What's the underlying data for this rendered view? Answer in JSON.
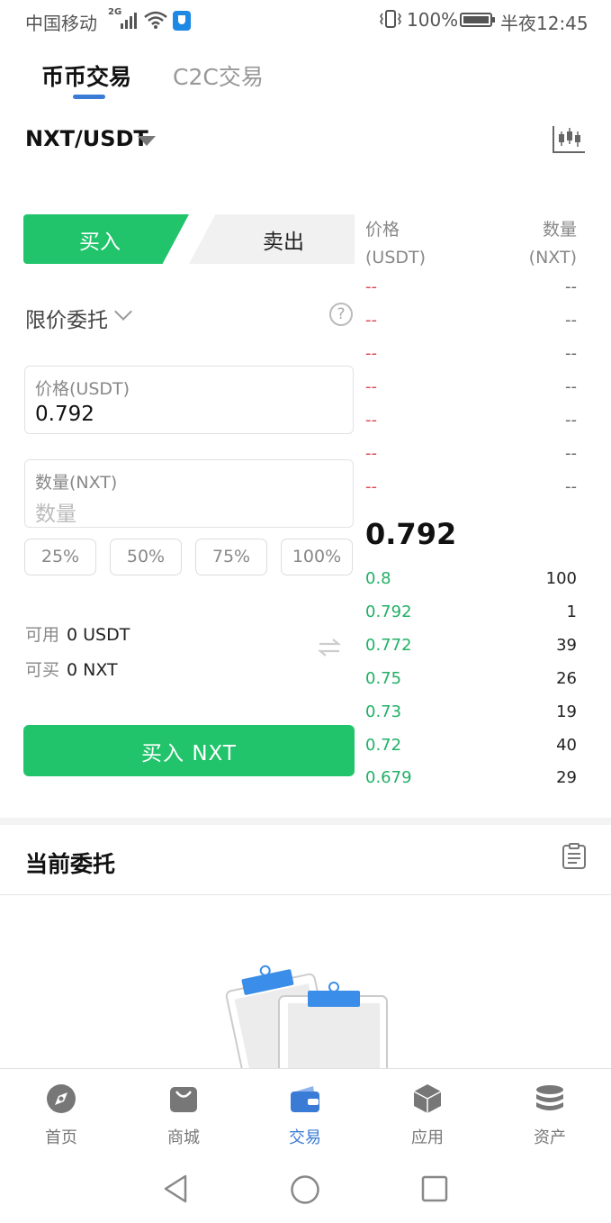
{
  "status_bar": {
    "carrier": "中国移动",
    "network": "2G",
    "battery_pct": "100%",
    "time": "半夜12:45"
  },
  "tabs": [
    {
      "label": "币币交易",
      "active": true
    },
    {
      "label": "C2C交易",
      "active": false
    }
  ],
  "pair": {
    "name": "NXT/USDT"
  },
  "side": {
    "buy": "买入",
    "sell": "卖出",
    "selected": "buy"
  },
  "order_type": {
    "label": "限价委托",
    "help_glyph": "?"
  },
  "price_field": {
    "label": "价格(USDT)",
    "value": "0.792"
  },
  "qty_field": {
    "label": "数量(NXT)",
    "placeholder": "数量"
  },
  "percent_buttons": [
    "25%",
    "50%",
    "75%",
    "100%"
  ],
  "available": {
    "usable_label": "可用",
    "usable_value": "0 USDT",
    "buyable_label": "可买",
    "buyable_value": "0 NXT"
  },
  "submit_label": "买入 NXT",
  "order_book": {
    "price_header": "价格",
    "price_unit": "(USDT)",
    "qty_header": "数量",
    "qty_unit": "(NXT)",
    "asks": [
      {
        "price": "--",
        "qty": "--"
      },
      {
        "price": "--",
        "qty": "--"
      },
      {
        "price": "--",
        "qty": "--"
      },
      {
        "price": "--",
        "qty": "--"
      },
      {
        "price": "--",
        "qty": "--"
      },
      {
        "price": "--",
        "qty": "--"
      },
      {
        "price": "--",
        "qty": "--"
      }
    ],
    "last_price": "0.792",
    "bids": [
      {
        "price": "0.8",
        "qty": "100"
      },
      {
        "price": "0.792",
        "qty": "1"
      },
      {
        "price": "0.772",
        "qty": "39"
      },
      {
        "price": "0.75",
        "qty": "26"
      },
      {
        "price": "0.73",
        "qty": "19"
      },
      {
        "price": "0.72",
        "qty": "40"
      },
      {
        "price": "0.679",
        "qty": "29"
      }
    ]
  },
  "current_orders": {
    "title": "当前委托"
  },
  "bottom_nav": [
    {
      "label": "首页",
      "icon": "compass-icon",
      "active": false
    },
    {
      "label": "商城",
      "icon": "shopping-bag-icon",
      "active": false
    },
    {
      "label": "交易",
      "icon": "wallet-icon",
      "active": true
    },
    {
      "label": "应用",
      "icon": "cube-icon",
      "active": false
    },
    {
      "label": "资产",
      "icon": "coins-stack-icon",
      "active": false
    }
  ],
  "colors": {
    "buy_green": "#21c46b",
    "ask_red": "#e0464e",
    "bid_green": "#21b066",
    "accent_blue": "#3a7bd5"
  }
}
